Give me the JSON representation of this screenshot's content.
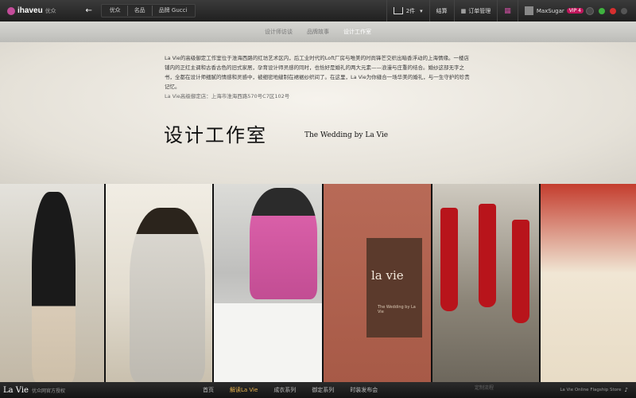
{
  "topbar": {
    "brand": "ihaveu",
    "brand_cn": "优众",
    "crumbs": [
      "优众",
      "名品",
      "品牌 Gucci"
    ],
    "cart_count": "2件",
    "checkout": "结算",
    "orders": "订单管理",
    "username": "MaxSugar",
    "level": "VIP 4"
  },
  "subnav": {
    "items": [
      "设计师访谈",
      "品牌故事",
      "设计工作室"
    ]
  },
  "content": {
    "intro": "La Vie的高级御定工作室位于淮海西路的红坊艺术区内，后工业时代的Loft厂房与唯美的时尚锋芒交织出暗香浮动的上海情缘。一楼店铺内的正红主调和古香古色的旧式家居，孕育设计师灵感的同时，也恰好是婚礼的两大元素——浪漫与庄重的结合。婚纱这部无字之书，全都在设计师细腻的情感和灵感中，被细密地缝制在裙裾纱织间了。在这里，La Vie为你缝合一场华美的婚礼，与一生守护的珍贵记忆。",
    "address": "La Vie高级御定店：上海市淮海西路570号C7区102号",
    "title_cn": "设计工作室",
    "title_en": "The Wedding by La Vie"
  },
  "photos": {
    "sign_logo": "la vie",
    "sign_tagline": "The Wedding by La Vie"
  },
  "footer": {
    "logo": "La Vie",
    "sub": "优众网官方授权",
    "nav": [
      "首页",
      "解读La Vie",
      "成衣系列",
      "御定系列",
      "时装发布会"
    ],
    "customize": "定制流程",
    "right": "La Vie Online Flagship Store"
  },
  "colors": {
    "topbar": "#2b2b2b",
    "accent": "#e8b24c",
    "badge": "#c0175c"
  }
}
